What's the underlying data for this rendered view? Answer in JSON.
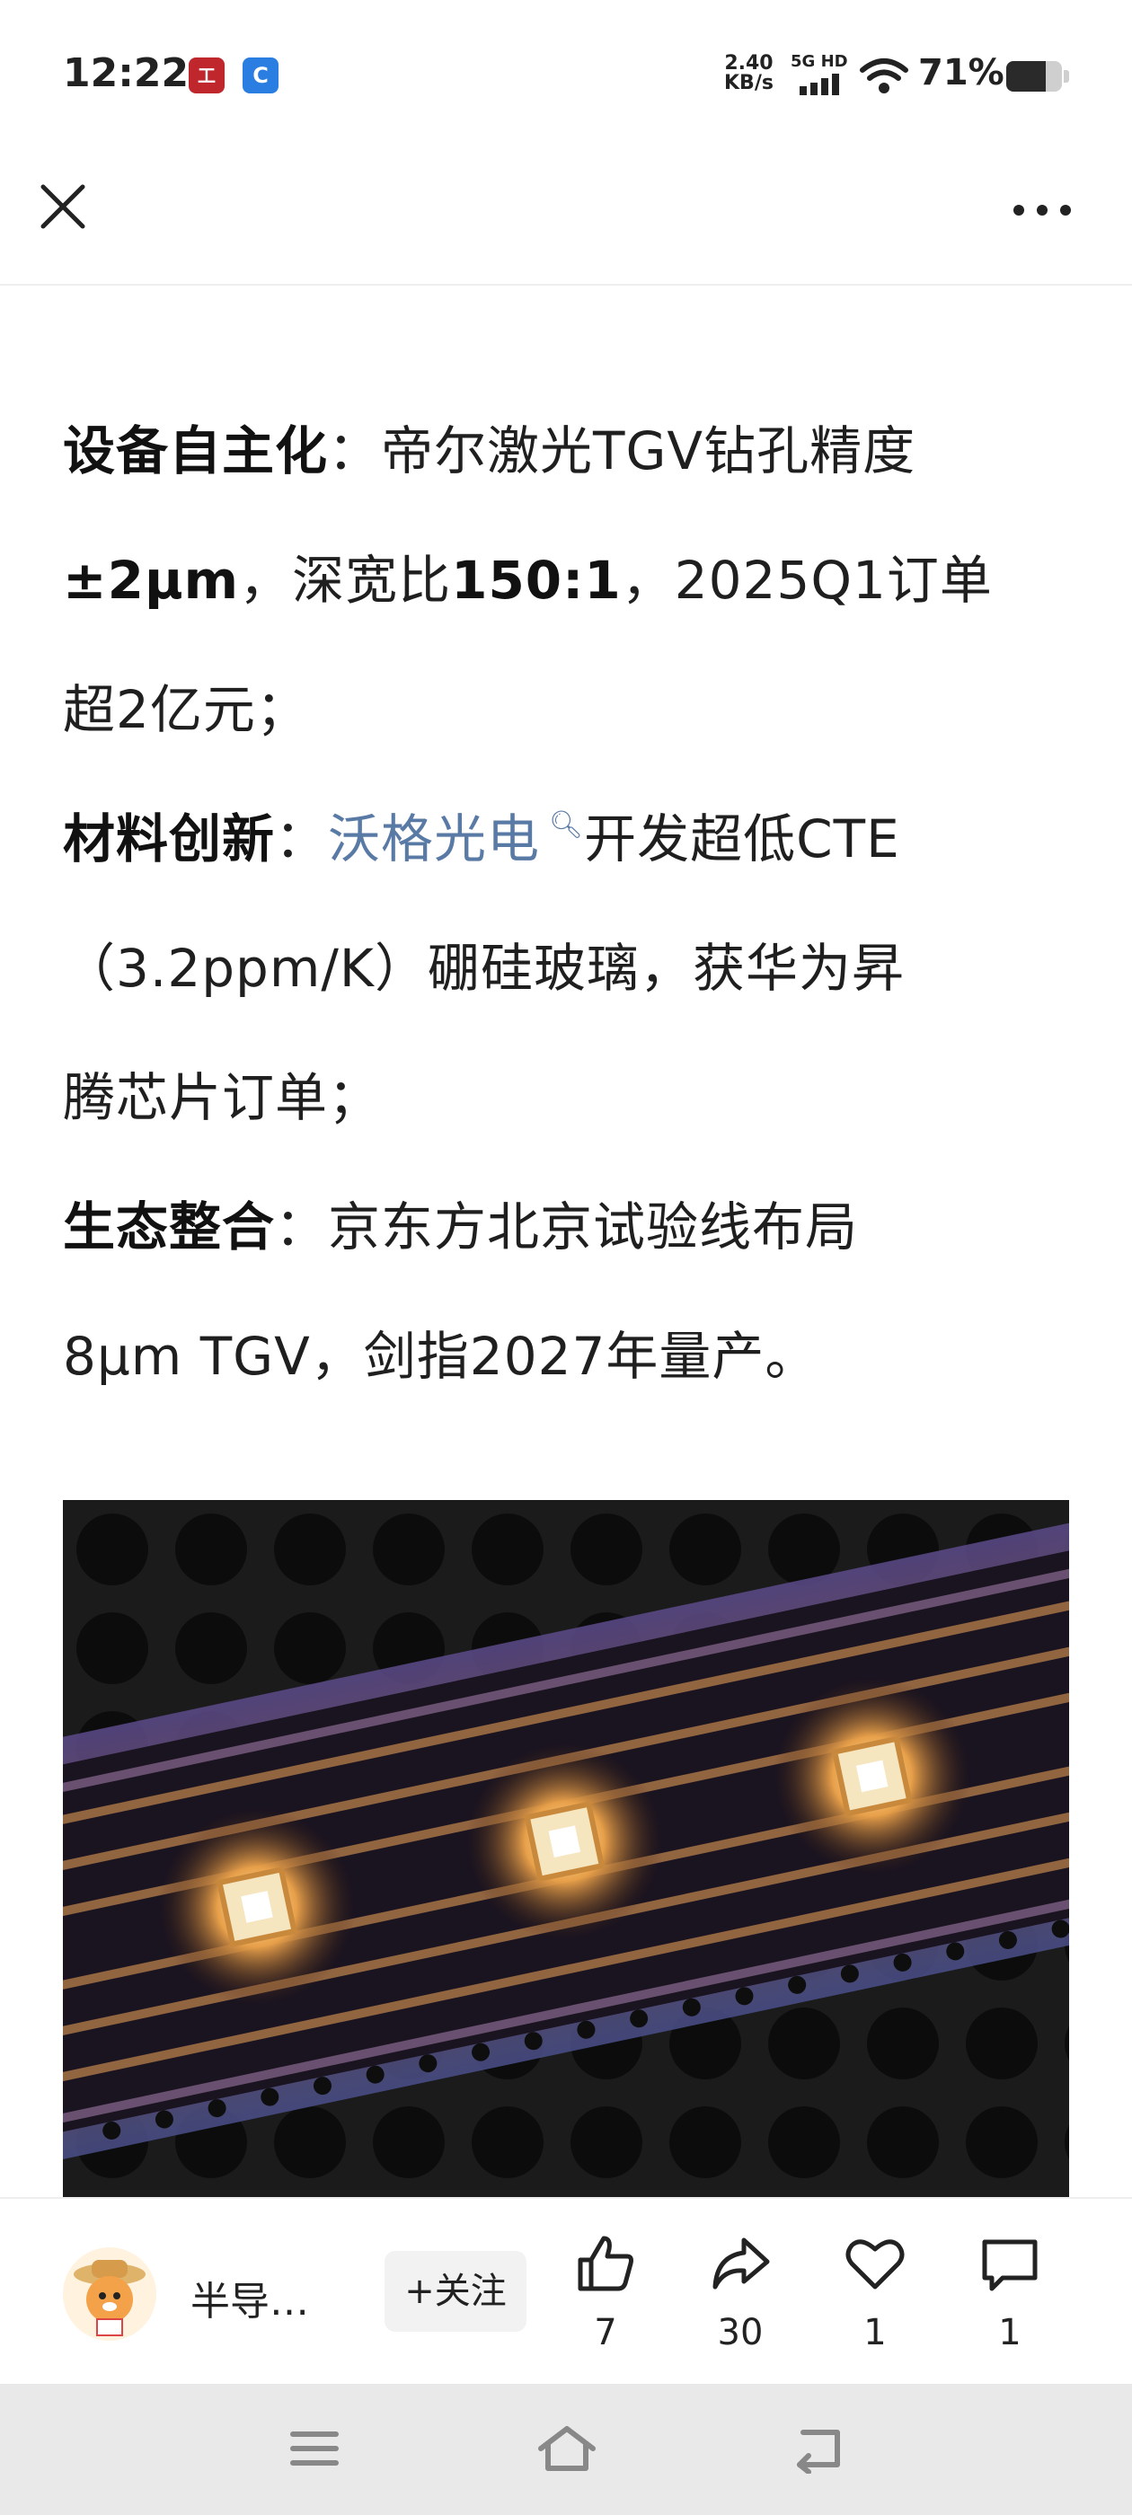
{
  "status": {
    "time": "12:22",
    "app1_icon": "bank-app-icon",
    "app2_icon": "browser-app-icon",
    "speed_value": "2.40",
    "speed_unit": "KB/s",
    "network": "5G HD",
    "battery": "71%",
    "battery_level": 0.71
  },
  "nav": {
    "close_icon": "close-icon",
    "more_icon": "more-icon"
  },
  "article": {
    "p1_label": "设备自主化",
    "p1_colon": "：",
    "p1_text1": "帝尔激光TGV钻孔精度",
    "p1_bold2": "±2μm",
    "p1_text2": "，深宽比",
    "p1_bold3": "150:1",
    "p1_text3": "，2025Q1订单",
    "p1_text4": "超2亿元；",
    "p2_label": "材料创新",
    "p2_colon": "：",
    "p2_link": "沃格光电",
    "p2_text1": "开发超低CTE",
    "p2_text2": "（3.2ppm/K）硼硅玻璃，获华为昇",
    "p2_text3": "腾芯片订单；",
    "p3_label": "生态整合",
    "p3_colon": "：",
    "p3_text1": "京东方北京试验线布局",
    "p3_text2": "8μm TGV，剑指2027年量产。"
  },
  "figure": {
    "description_icon": "chip-image"
  },
  "actionbar": {
    "author": "半导…",
    "follow": "+关注",
    "like_count": "7",
    "share_count": "30",
    "favorite_count": "1",
    "comment_count": "1"
  },
  "colors": {
    "link": "#5a7aa6",
    "background": "#ffffff",
    "navbar": "#e9e9e9"
  }
}
